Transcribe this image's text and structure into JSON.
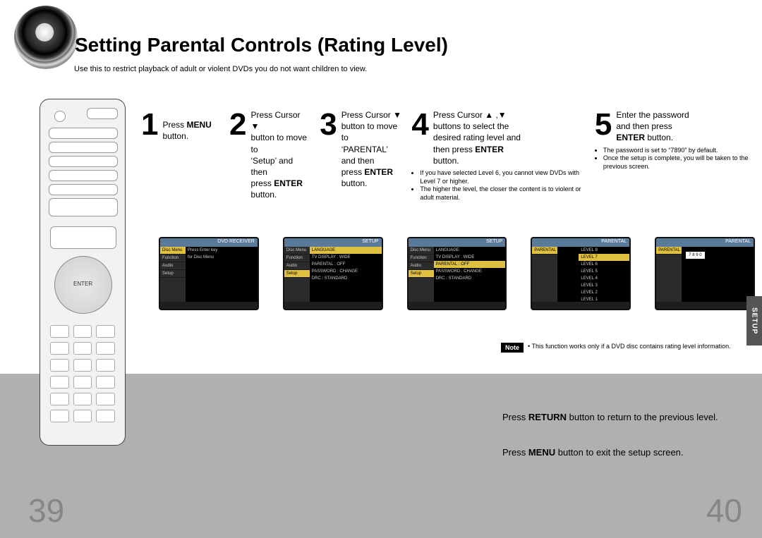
{
  "title": "Setting Parental Controls (Rating Level)",
  "subtitle": "Use this to restrict playback of adult or violent DVDs you do not want children to view.",
  "sidetab": "SETUP",
  "steps": {
    "s1": {
      "num": "1",
      "line1": "Press ",
      "bold1": "MENU",
      "line2": " button."
    },
    "s2": {
      "num": "2",
      "a": "Press Cursor ▼",
      "b": "button to move to",
      "c": "‘Setup’ and then",
      "d": "press ",
      "dbold": "ENTER",
      "e": " button."
    },
    "s3": {
      "num": "3",
      "a": "Press Cursor ▼",
      "b": "button to move to",
      "c": "‘PARENTAL’ and then",
      "d": "press ",
      "dbold": "ENTER",
      "e": " button."
    },
    "s4": {
      "num": "4",
      "a": "Press Cursor ▲ ,▼",
      "b": "buttons to select the",
      "c": "desired rating level and",
      "d": "then press ",
      "dbold": "ENTER",
      "e": " button.",
      "notes": [
        "If you have selected Level 6, you cannot view DVDs with Level 7 or higher.",
        "The higher the level, the closer the content is to violent or adult material."
      ]
    },
    "s5": {
      "num": "5",
      "a": "Enter the password",
      "b": "and then press",
      "cbold": "ENTER",
      "c": " button.",
      "notes": [
        "The password is set to “7890” by default.",
        "Once the setup is complete, you will be taken to the previous screen."
      ]
    }
  },
  "note": {
    "label": "Note",
    "text": "This function works only if a DVD disc contains rating level information."
  },
  "return_line_a": "Press ",
  "return_bold": "RETURN",
  "return_line_b": " button to return to the previous level.",
  "menu_line_a": "Press ",
  "menu_bold": "MENU",
  "menu_line_b": " button to exit the setup screen.",
  "page_left": "39",
  "page_right": "40",
  "osd": {
    "hdr1": "DVD RECEIVER",
    "hdr2": "SETUP",
    "hdr3": "PARENTAL",
    "side": [
      "Disc Menu",
      "Function",
      "Audio",
      "Setup"
    ],
    "main1a": "Press Enter key",
    "main1b": "for Disc Menu",
    "langline": "LANGUAGE",
    "tvline": "TV DISPLAY     : WIDE",
    "parline": "PARENTAL      : OFF",
    "pwline": "PASSWORD     : CHANGE",
    "drcline": "DRC               : STANDARD",
    "levels": [
      "LEVEL 8",
      "LEVEL 7",
      "LEVEL 6",
      "LEVEL 5",
      "LEVEL 4",
      "LEVEL 3",
      "LEVEL 2",
      "LEVEL 1"
    ],
    "pw": "7 8 9 0"
  }
}
